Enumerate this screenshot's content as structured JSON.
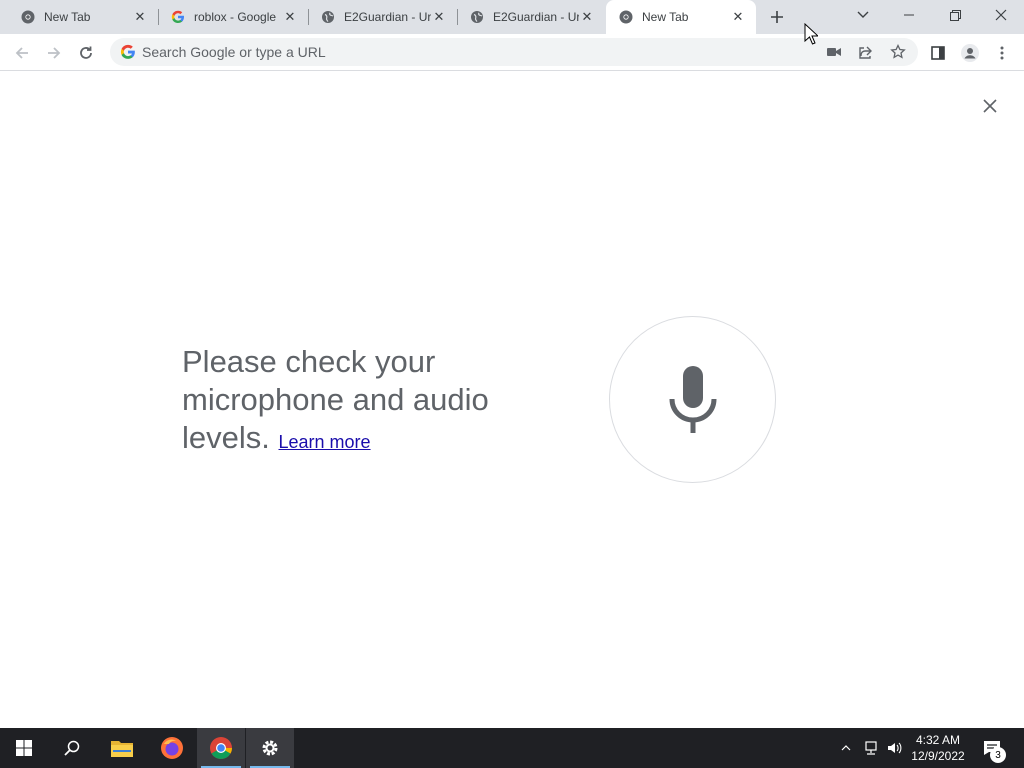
{
  "browser": {
    "tabs": [
      {
        "title": "New Tab",
        "icon": "chrome-icon"
      },
      {
        "title": "roblox - Google",
        "icon": "google-icon"
      },
      {
        "title": "E2Guardian - Ur",
        "icon": "globe-icon"
      },
      {
        "title": "E2Guardian - Ur",
        "icon": "globe-icon"
      },
      {
        "title": "New Tab",
        "icon": "chrome-icon",
        "active": true
      }
    ],
    "omnibox_placeholder": "Search Google or type a URL"
  },
  "voice_search": {
    "message": "Please check your microphone and audio levels.",
    "learn_more": "Learn more"
  },
  "taskbar": {
    "time": "4:32 AM",
    "date": "12/9/2022",
    "notification_count": "3"
  },
  "colors": {
    "tabstrip": "#dee1e6",
    "link": "#1a0dab",
    "mic": "#5f6368",
    "taskbar": "#1f2024"
  }
}
